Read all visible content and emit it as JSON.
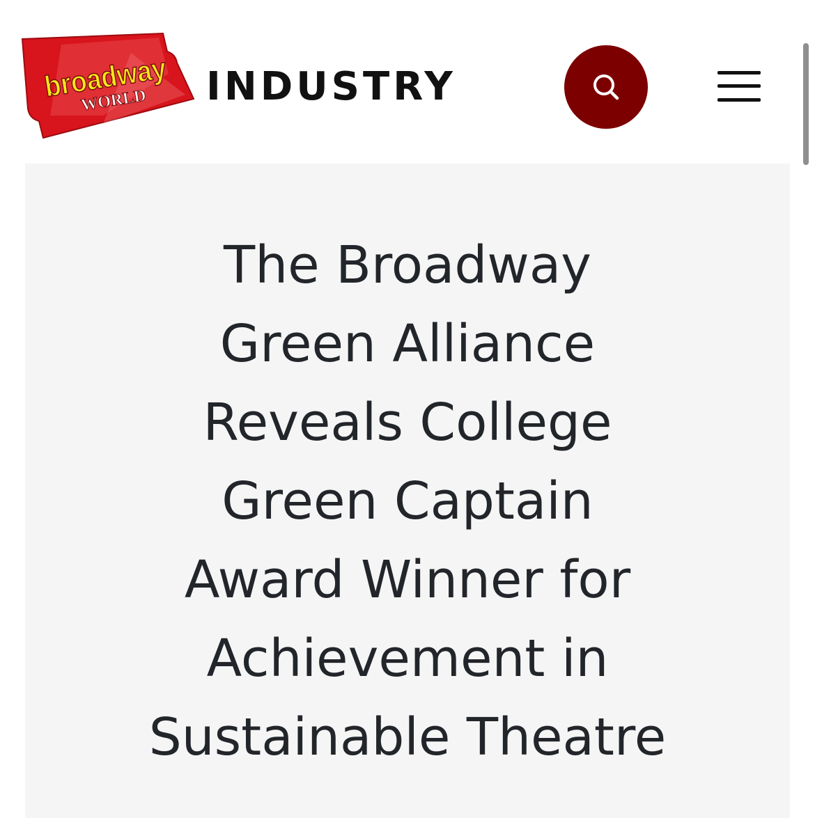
{
  "header": {
    "logo_top_text": "broadway",
    "logo_bottom_text": "WORLD",
    "section_title": "INDUSTRY",
    "search_button_color": "#7d0000",
    "search_icon": "search-icon",
    "menu_icon": "hamburger-menu-icon"
  },
  "article": {
    "headline_lines": [
      "The Broadway",
      "Green Alliance",
      "Reveals College",
      "Green Captain",
      "Award Winner for",
      "Achievement in",
      "Sustainable Theatre"
    ]
  },
  "colors": {
    "logo_red": "#d8141c",
    "logo_yellow": "#f6e71a",
    "panel_background": "#f5f5f5",
    "headline_text": "#22252a"
  }
}
